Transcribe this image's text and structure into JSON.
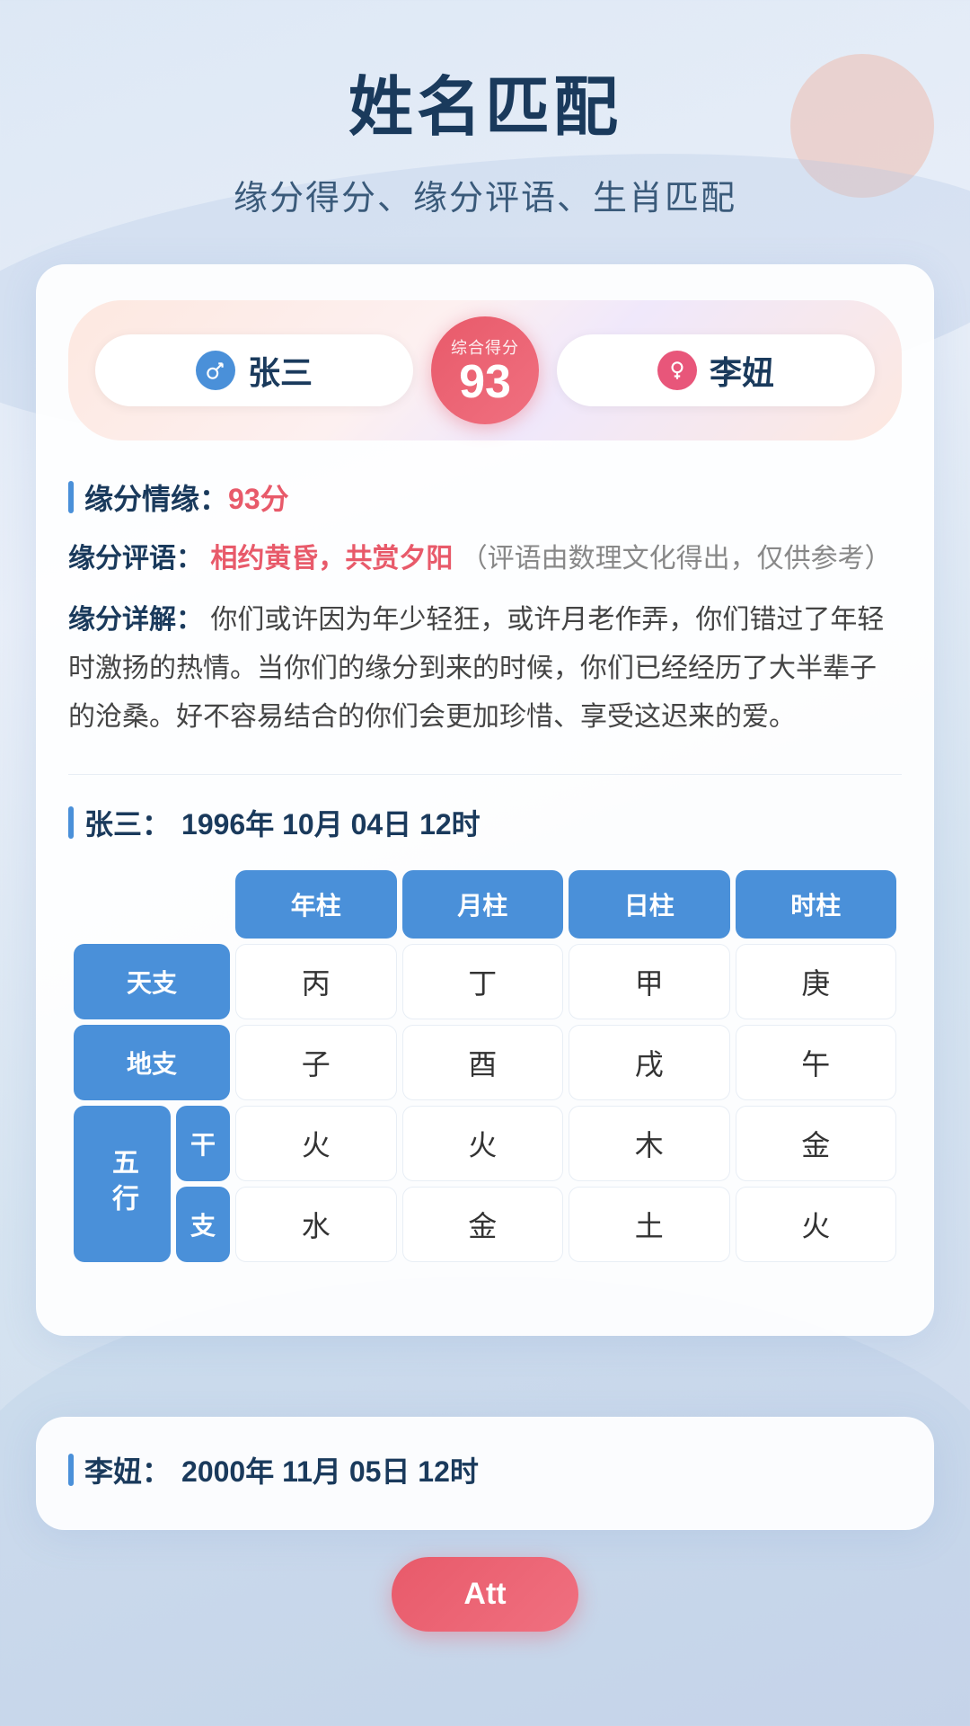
{
  "page": {
    "title": "姓名匹配",
    "subtitle": "缘分得分、缘分评语、生肖匹配"
  },
  "score_section": {
    "male": {
      "name": "张三",
      "icon": "♂"
    },
    "female": {
      "name": "李妞",
      "icon": "♀"
    },
    "score_label": "综合得分",
    "score": "93"
  },
  "yuanfen": {
    "section_title": "缘分情缘：",
    "score_display": "93分",
    "review_label": "缘分评语：",
    "review_highlight": "相约黄昏，共赏夕阳",
    "review_note": "（评语由数理文化得出，仅供参考）",
    "detail_label": "缘分详解：",
    "detail_text": "你们或许因为年少轻狂，或许月老作弄，你们错过了年轻时激扬的热情。当你们的缘分到来的时候，你们已经经历了大半辈子的沧桑。好不容易结合的你们会更加珍惜、享受这迟来的爱。"
  },
  "person1": {
    "section_prefix": "张三：",
    "birth_info": "1996年 10月 04日 12时",
    "table": {
      "headers": [
        "年柱",
        "月柱",
        "日柱",
        "时柱"
      ],
      "tiangan_label": "天支",
      "tiangan": [
        "丙",
        "丁",
        "甲",
        "庚"
      ],
      "dizhi_label": "地支",
      "dizhi": [
        "子",
        "酉",
        "戌",
        "午"
      ],
      "wuxing_label": "五行",
      "gan_label": "干",
      "zhi_label": "支",
      "wuxing_gan": [
        "火",
        "火",
        "木",
        "金"
      ],
      "wuxing_zhi": [
        "水",
        "金",
        "土",
        "火"
      ]
    }
  },
  "person2": {
    "section_prefix": "李妞：",
    "birth_info": "2000年 11月 05日 12时"
  },
  "cta": {
    "button_label": "Att"
  }
}
